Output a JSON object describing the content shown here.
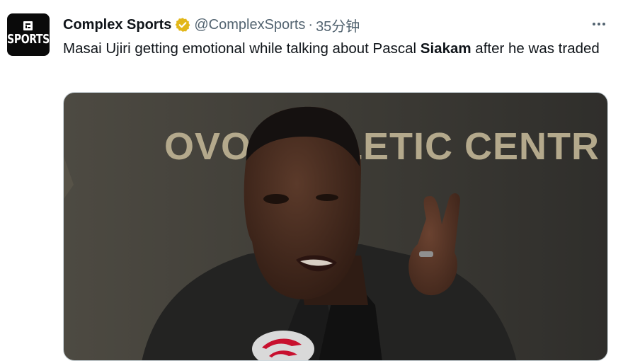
{
  "tweet": {
    "author": {
      "display_name": "Complex Sports",
      "handle": "@ComplexSports",
      "verified": true,
      "avatar_text": "SPORTS"
    },
    "separator": "·",
    "timestamp": "35分钟",
    "text_before": "Masai Ujiri getting emotional while talking about Pascal ",
    "text_bold": "Siakam",
    "text_after": " after he was traded",
    "media": {
      "backdrop_text": "OVO ATHLETIC CENTR"
    }
  },
  "icons": {
    "verified": "verified-badge-icon",
    "more": "more-horizontal-icon"
  },
  "colors": {
    "text_primary": "#0f1419",
    "text_secondary": "#536471",
    "verified_gold": "#e2b719",
    "media_border": "#cfd9de"
  }
}
